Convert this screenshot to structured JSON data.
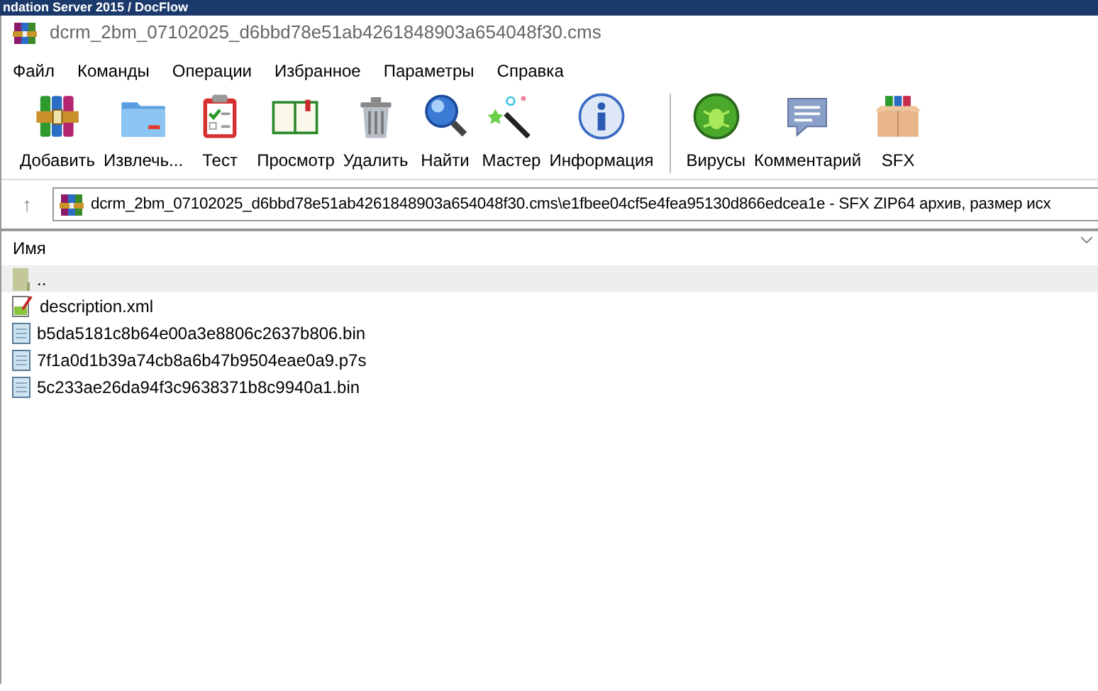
{
  "background_window": {
    "title": "ndation Server 2015   /   DocFlow"
  },
  "window": {
    "title": "dcrm_2bm_07102025_d6bbd78e51ab4261848903a654048f30.cms"
  },
  "menu": [
    "Файл",
    "Команды",
    "Операции",
    "Избранное",
    "Параметры",
    "Справка"
  ],
  "toolbar": {
    "groups": [
      [
        "Добавить",
        "Извлечь...",
        "Тест",
        "Просмотр",
        "Удалить",
        "Найти",
        "Мастер",
        "Информация"
      ],
      [
        "Вирусы",
        "Комментарий",
        "SFX"
      ]
    ]
  },
  "address_bar": {
    "up_button": "↑",
    "path": "dcrm_2bm_07102025_d6bbd78e51ab4261848903a654048f30.cms\\e1fbee04cf5e4fea95130d866edcea1e - SFX ZIP64 архив, размер исх"
  },
  "file_list": {
    "columns": [
      "Имя"
    ],
    "rows": [
      {
        "kind": "parent",
        "name": "..",
        "selected": true
      },
      {
        "kind": "xml",
        "name": "description.xml",
        "selected": false
      },
      {
        "kind": "file",
        "name": "b5da5181c8b64e00a3e8806c2637b806.bin",
        "selected": false
      },
      {
        "kind": "file",
        "name": "7f1a0d1b39a74cb8a6b47b9504eae0a9.p7s",
        "selected": false
      },
      {
        "kind": "file",
        "name": "5c233ae26da94f3c9638371b8c9940a1.bin",
        "selected": false
      }
    ]
  }
}
